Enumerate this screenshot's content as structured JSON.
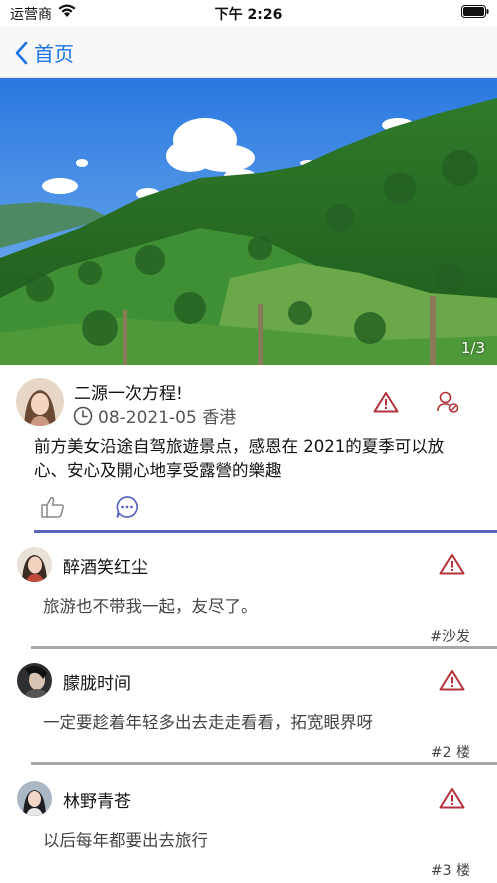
{
  "status_bar": {
    "carrier": "运营商",
    "time": "下午 2:26"
  },
  "nav": {
    "back_label": "首页"
  },
  "banner": {
    "counter": "1/3"
  },
  "post": {
    "title": "二源一次方程!",
    "meta": "08-2021-05 香港",
    "body": "前方美女沿途自驾旅遊景点，感恩在 2021的夏季可以放心、安心及開心地享受露營的樂趣"
  },
  "comments": [
    {
      "name": "醉酒笑红尘",
      "text": "旅游也不带我一起，友尽了。",
      "floor": "#沙发"
    },
    {
      "name": "朦胧时间",
      "text": "一定要趁着年轻多出去走走看看，拓宽眼界呀",
      "floor": "#2 楼"
    },
    {
      "name": "林野青苍",
      "text": "以后每年都要出去旅行",
      "floor": "#3 楼"
    }
  ],
  "colors": {
    "accent": "#1a74e8",
    "report": "#b3333a",
    "divider_active": "#5c66c0",
    "divider": "#a8a8a8"
  }
}
